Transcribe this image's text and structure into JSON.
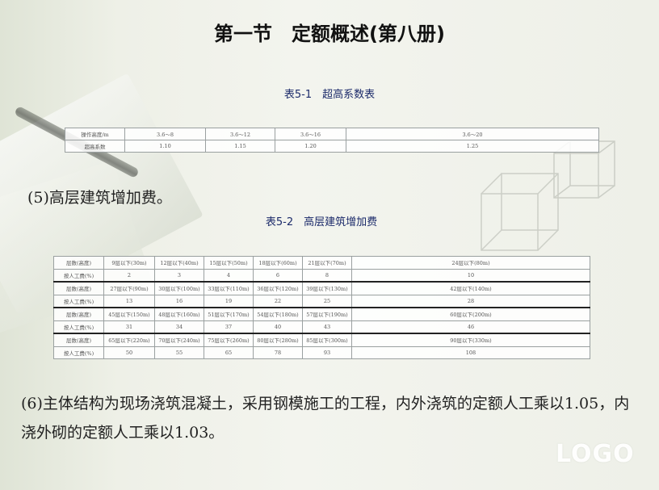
{
  "title": "第一节　定额概述(第八册)",
  "table1": {
    "caption": "表5-1　超高系数表",
    "rows": [
      [
        "操作高度/m",
        "3.6～8",
        "3.6～12",
        "3.6～16",
        "3.6～20"
      ],
      [
        "超高系数",
        "1.10",
        "1.15",
        "1.20",
        "1.25"
      ]
    ]
  },
  "section5": "(5)高层建筑增加费。",
  "table2": {
    "caption": "表5-2　高层建筑增加费",
    "groups": [
      {
        "floors": [
          "层数(高度)",
          "9层以下(30m)",
          "12层以下(40m)",
          "15层以下(50m)",
          "18层以下(60m)",
          "21层以下(70m)",
          "24层以下(80m)"
        ],
        "pct": [
          "按人工费(%)",
          "2",
          "3",
          "4",
          "6",
          "8",
          "10"
        ]
      },
      {
        "floors": [
          "层数(高度)",
          "27层以下(90m)",
          "30层以下(100m)",
          "33层以下(110m)",
          "36层以下(120m)",
          "39层以下(130m)",
          "42层以下(140m)"
        ],
        "pct": [
          "按人工费(%)",
          "13",
          "16",
          "19",
          "22",
          "25",
          "28"
        ]
      },
      {
        "floors": [
          "层数(高度)",
          "45层以下(150m)",
          "48层以下(160m)",
          "51层以下(170m)",
          "54层以下(180m)",
          "57层以下(190m)",
          "60层以下(200m)"
        ],
        "pct": [
          "按人工费(%)",
          "31",
          "34",
          "37",
          "40",
          "43",
          "46"
        ]
      },
      {
        "floors": [
          "层数(高度)",
          "65层以下(220m)",
          "70层以下(240m)",
          "75层以下(260m)",
          "80层以下(280m)",
          "85层以下(300m)",
          "90层以下(330m)"
        ],
        "pct": [
          "按人工费(%)",
          "50",
          "55",
          "65",
          "78",
          "93",
          "108"
        ]
      }
    ]
  },
  "section6": "(6)主体结构为现场浇筑混凝土，采用钢模施工的工程，内外浇筑的定额人工乘以1.05，内浇外砌的定额人工乘以1.03。",
  "logo": "LOGO"
}
